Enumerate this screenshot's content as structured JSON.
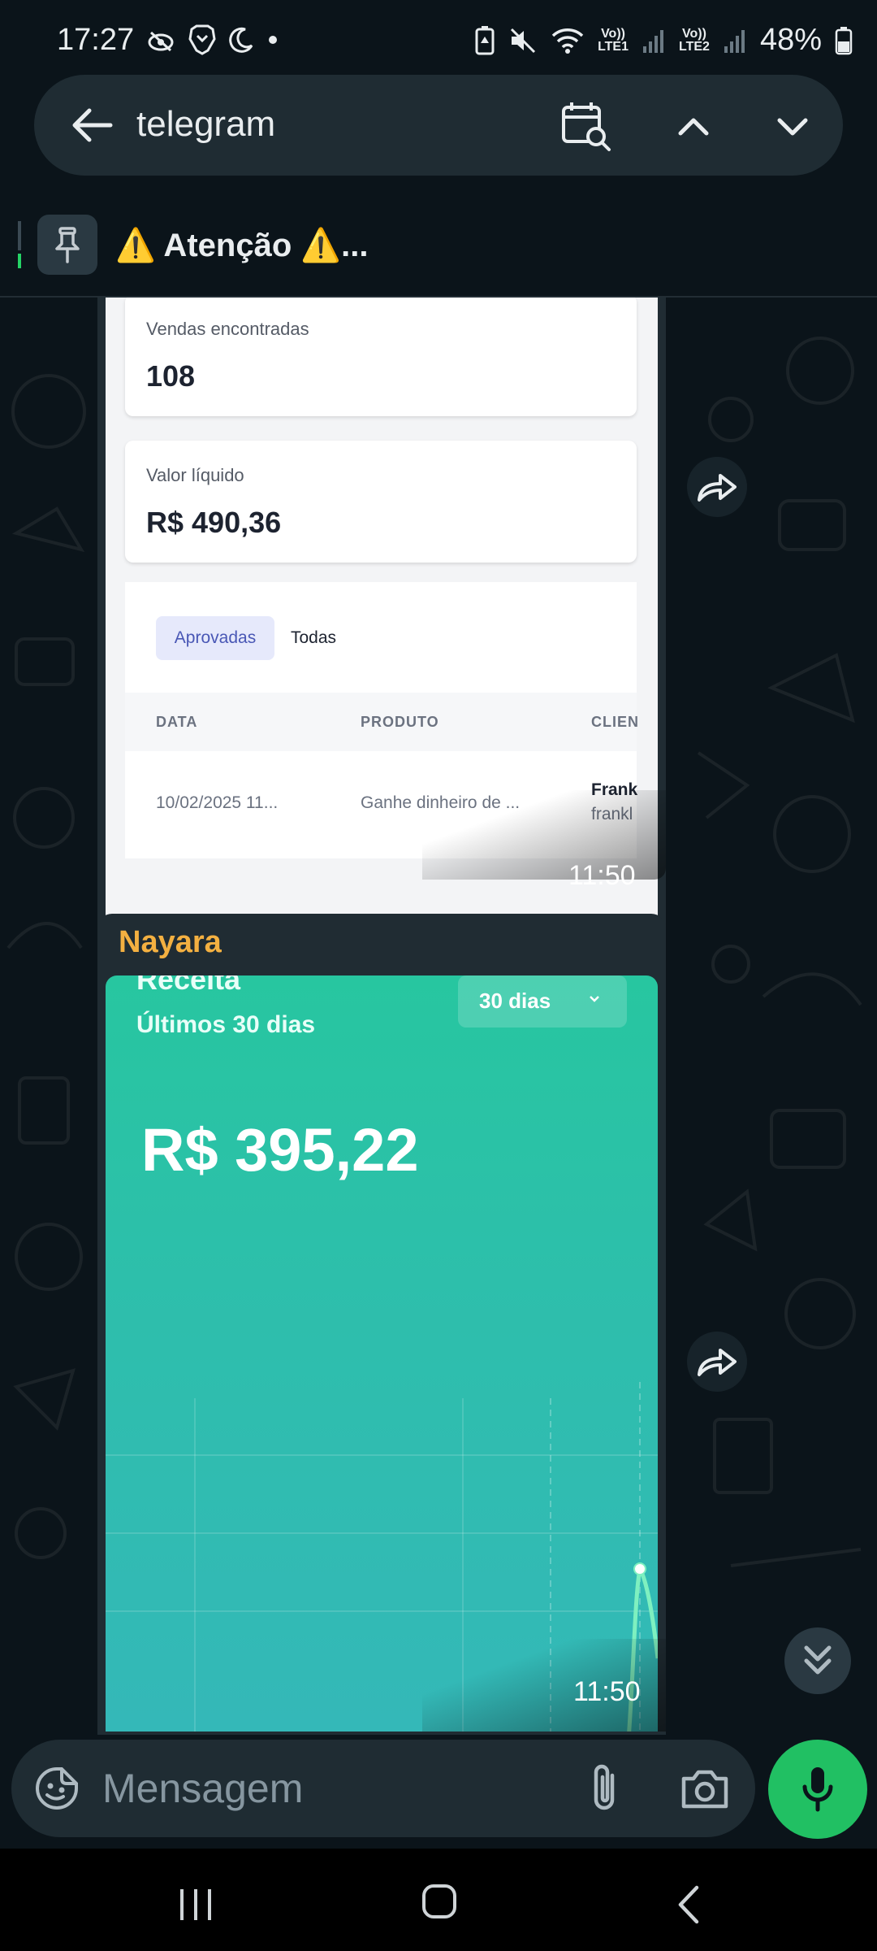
{
  "status_bar": {
    "time": "17:27",
    "battery": "48%",
    "sim1_label_top": "Vo))",
    "sim1_label_bottom": "LTE1",
    "sim2_label_top": "Vo))",
    "sim2_label_bottom": "LTE2"
  },
  "search": {
    "query": "telegram"
  },
  "pinned": {
    "text": "⚠️ Atenção ⚠️..."
  },
  "message1": {
    "sales_found_label": "Vendas encontradas",
    "sales_found_value": "108",
    "net_value_label": "Valor líquido",
    "net_value": "R$ 490,36",
    "tab_approved": "Aprovadas",
    "tab_all": "Todas",
    "columns": [
      "DATA",
      "PRODUTO",
      "CLIEN"
    ],
    "row": {
      "date": "10/02/2025 11...",
      "product": "Ganhe dinheiro de ...",
      "client_name": "Frank",
      "client_email": "frankl"
    },
    "time": "11:50"
  },
  "message2": {
    "sender": "Nayara",
    "card_title": "Receita",
    "period_subtitle": "Últimos 30 dias",
    "period_select": "30 dias",
    "revenue": "R$ 395,22",
    "time": "11:50"
  },
  "composer": {
    "placeholder": "Mensagem"
  },
  "colors": {
    "chat_background": "#0b141a",
    "bubble": "#202c33",
    "sender_name": "#f3b041",
    "mic_button": "#21c063",
    "revenue_card": "#27c6a0"
  }
}
